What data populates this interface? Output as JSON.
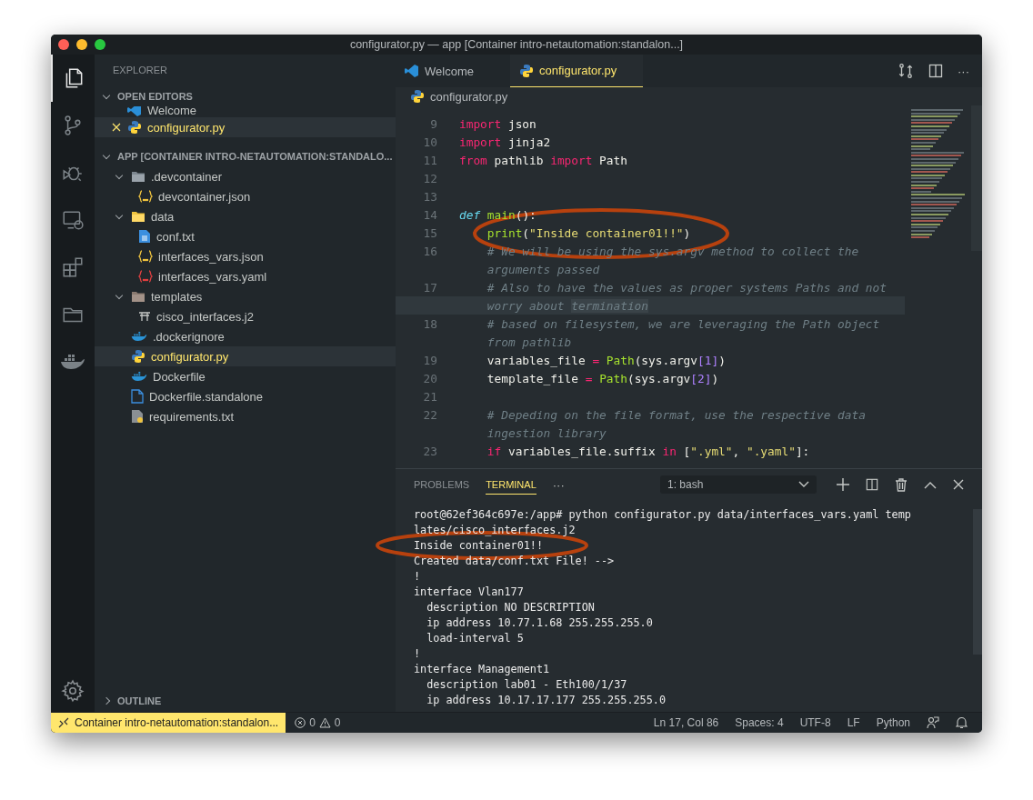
{
  "window": {
    "title": "configurator.py — app [Container intro-netautomation:standalon...]"
  },
  "activity_bar": [
    {
      "kind": "files",
      "selected": true
    },
    {
      "kind": "source-control",
      "selected": false
    },
    {
      "kind": "debug",
      "selected": false
    },
    {
      "kind": "remote",
      "selected": false
    },
    {
      "kind": "extensions",
      "selected": false
    },
    {
      "kind": "folder",
      "selected": false
    },
    {
      "kind": "docker",
      "selected": false
    }
  ],
  "explorer": {
    "title": "EXPLORER",
    "open_editors": {
      "title": "OPEN EDITORS",
      "expanded": true,
      "items": [
        {
          "label": "Welcome",
          "kind": "vscode",
          "selected": false,
          "modified": false
        },
        {
          "label": "configurator.py",
          "kind": "python",
          "selected": true,
          "modified": true
        }
      ]
    },
    "folder": {
      "title": "APP [CONTAINER INTRO-NETAUTOMATION:STANDALO...",
      "expanded": true,
      "tree": [
        {
          "kind": "folder",
          "label": ".devcontainer",
          "expanded": true,
          "selected": false,
          "modified": false,
          "children": [
            {
              "kind": "json",
              "label": "devcontainer.json",
              "selected": false,
              "modified": false
            }
          ]
        },
        {
          "kind": "data-folder",
          "label": "data",
          "expanded": true,
          "selected": false,
          "modified": false,
          "children": [
            {
              "kind": "text",
              "label": "conf.txt",
              "selected": false,
              "modified": false
            },
            {
              "kind": "json",
              "label": "interfaces_vars.json",
              "selected": false,
              "modified": false
            },
            {
              "kind": "yaml",
              "label": "interfaces_vars.yaml",
              "selected": false,
              "modified": false
            }
          ]
        },
        {
          "kind": "templates-folder",
          "label": "templates",
          "expanded": true,
          "selected": false,
          "modified": false,
          "children": [
            {
              "kind": "jinja",
              "label": "cisco_interfaces.j2",
              "selected": false,
              "modified": false
            }
          ]
        },
        {
          "kind": "docker",
          "label": ".dockerignore",
          "selected": false,
          "modified": false
        },
        {
          "kind": "python",
          "label": "configurator.py",
          "selected": true,
          "modified": true
        },
        {
          "kind": "docker",
          "label": "Dockerfile",
          "selected": false,
          "modified": false
        },
        {
          "kind": "file",
          "label": "Dockerfile.standalone",
          "selected": false,
          "modified": false
        },
        {
          "kind": "requirements",
          "label": "requirements.txt",
          "selected": false,
          "modified": false
        }
      ]
    },
    "outline": {
      "title": "OUTLINE",
      "expanded": false
    }
  },
  "tabs": [
    {
      "label": "Welcome",
      "kind": "vscode",
      "selected": false
    },
    {
      "label": "configurator.py",
      "kind": "python",
      "selected": true
    }
  ],
  "tab_actions": {
    "more": "···"
  },
  "breadcrumb": {
    "label": "configurator.py"
  },
  "code": [
    {
      "number": "9",
      "current": false,
      "rows": [
        [
          {
            "kind": "kw",
            "text": "import"
          },
          {
            "kind": "plain",
            "text": " json"
          }
        ]
      ]
    },
    {
      "number": "10",
      "current": false,
      "rows": [
        [
          {
            "kind": "kw",
            "text": "import"
          },
          {
            "kind": "plain",
            "text": " jinja2"
          }
        ]
      ]
    },
    {
      "number": "11",
      "current": false,
      "rows": [
        [
          {
            "kind": "kw",
            "text": "from"
          },
          {
            "kind": "plain",
            "text": " pathlib "
          },
          {
            "kind": "kw",
            "text": "import"
          },
          {
            "kind": "plain",
            "text": " Path"
          }
        ]
      ]
    },
    {
      "number": "12",
      "current": false,
      "rows": [
        []
      ]
    },
    {
      "number": "13",
      "current": false,
      "rows": [
        []
      ]
    },
    {
      "number": "14",
      "current": false,
      "rows": [
        [
          {
            "kind": "def",
            "text": "def"
          },
          {
            "kind": "plain",
            "text": " "
          },
          {
            "kind": "fn",
            "text": "main"
          },
          {
            "kind": "plain",
            "text": "():"
          }
        ]
      ]
    },
    {
      "number": "15",
      "current": false,
      "rows": [
        [
          {
            "kind": "plain",
            "text": "    "
          },
          {
            "kind": "fn",
            "text": "print"
          },
          {
            "kind": "plain",
            "text": "("
          },
          {
            "kind": "str",
            "text": "\"Inside container01!!\""
          },
          {
            "kind": "plain",
            "text": ")"
          }
        ]
      ]
    },
    {
      "number": "16",
      "current": false,
      "rows": [
        [
          {
            "kind": "plain",
            "text": "    "
          },
          {
            "kind": "cm",
            "text": "# We will be using the sys.argv method to collect the"
          }
        ],
        [
          {
            "kind": "plain",
            "text": "    "
          },
          {
            "kind": "cm",
            "text": "arguments passed"
          }
        ]
      ]
    },
    {
      "number": "17",
      "current": true,
      "rows": [
        [
          {
            "kind": "plain",
            "text": "    "
          },
          {
            "kind": "cm",
            "text": "# Also to have the values as proper systems Paths and not"
          }
        ],
        [
          {
            "kind": "plain",
            "text": "    "
          },
          {
            "kind": "cm",
            "text": "worry about "
          },
          {
            "kind": "cm-match",
            "text": "termination"
          }
        ]
      ]
    },
    {
      "number": "18",
      "current": false,
      "rows": [
        [
          {
            "kind": "plain",
            "text": "    "
          },
          {
            "kind": "cm",
            "text": "# based on filesystem, we are leveraging the Path object"
          }
        ],
        [
          {
            "kind": "plain",
            "text": "    "
          },
          {
            "kind": "cm",
            "text": "from pathlib"
          }
        ]
      ]
    },
    {
      "number": "19",
      "current": false,
      "rows": [
        [
          {
            "kind": "plain",
            "text": "    variables_file "
          },
          {
            "kind": "op",
            "text": "="
          },
          {
            "kind": "plain",
            "text": " "
          },
          {
            "kind": "fn",
            "text": "Path"
          },
          {
            "kind": "plain",
            "text": "(sys.argv"
          },
          {
            "kind": "num",
            "text": "[1]"
          },
          {
            "kind": "plain",
            "text": ")"
          }
        ]
      ]
    },
    {
      "number": "20",
      "current": false,
      "rows": [
        [
          {
            "kind": "plain",
            "text": "    template_file "
          },
          {
            "kind": "op",
            "text": "="
          },
          {
            "kind": "plain",
            "text": " "
          },
          {
            "kind": "fn",
            "text": "Path"
          },
          {
            "kind": "plain",
            "text": "(sys.argv"
          },
          {
            "kind": "num",
            "text": "[2]"
          },
          {
            "kind": "plain",
            "text": ")"
          }
        ]
      ]
    },
    {
      "number": "21",
      "current": false,
      "rows": [
        []
      ]
    },
    {
      "number": "22",
      "current": false,
      "rows": [
        [
          {
            "kind": "plain",
            "text": "    "
          },
          {
            "kind": "cm",
            "text": "# Depeding on the file format, use the respective data"
          }
        ],
        [
          {
            "kind": "plain",
            "text": "    "
          },
          {
            "kind": "cm",
            "text": "ingestion library"
          }
        ]
      ]
    },
    {
      "number": "23",
      "current": false,
      "rows": [
        [
          {
            "kind": "plain",
            "text": "    "
          },
          {
            "kind": "kw",
            "text": "if"
          },
          {
            "kind": "plain",
            "text": " variables_file.suffix "
          },
          {
            "kind": "op",
            "text": "in"
          },
          {
            "kind": "plain",
            "text": " ["
          },
          {
            "kind": "str",
            "text": "\".yml\""
          },
          {
            "kind": "plain",
            "text": ", "
          },
          {
            "kind": "str",
            "text": "\".yaml\""
          },
          {
            "kind": "plain",
            "text": "]:"
          }
        ]
      ]
    }
  ],
  "panel": {
    "tabs": [
      {
        "label": "PROBLEMS",
        "selected": false
      },
      {
        "label": "TERMINAL",
        "selected": true
      }
    ],
    "more": "···",
    "terminal_select": "1: bash",
    "terminal": [
      "root@62ef364c697e:/app# python configurator.py data/interfaces_vars.yaml temp",
      "lates/cisco_interfaces.j2",
      "Inside container01!!",
      "Created data/conf.txt File! -->",
      "!",
      "interface Vlan177",
      "  description NO DESCRIPTION",
      "  ip address 10.77.1.68 255.255.255.0",
      "  load-interval 5",
      "!",
      "interface Management1",
      "  description lab01 - Eth100/1/37",
      "  ip address 10.17.17.177 255.255.255.0"
    ]
  },
  "status_bar": {
    "remote": "Container intro-netautomation:standalon...",
    "errors": "0",
    "warnings": "0",
    "right": [
      "Ln 17, Col 86",
      "Spaces: 4",
      "UTF-8",
      "LF",
      "Python"
    ]
  }
}
